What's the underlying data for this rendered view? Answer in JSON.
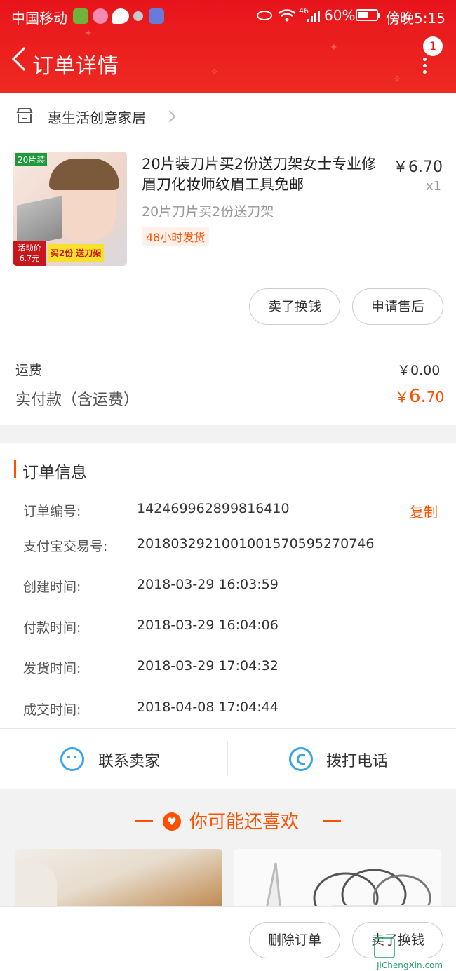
{
  "status_bar": {
    "carrier": "中国移动",
    "net": "46",
    "battery": "60%",
    "battery_level": 0.6,
    "time": "傍晚5:15"
  },
  "header": {
    "title": "订单详情",
    "badge": "1"
  },
  "shop": {
    "name": "惠生活创意家居"
  },
  "product": {
    "title": "20片装刀片买2份送刀架女士专业修眉刀化妆师纹眉工具免邮",
    "price": "￥6.70",
    "qty": "x1",
    "spec": "20片刀片买2份送刀架",
    "tag": "48小时发货",
    "image_texts": {
      "count_tag": "20片装",
      "promo_label": "活动价",
      "promo_price": "6.7元",
      "promo_banner": "买2份 送刀架"
    }
  },
  "item_actions": {
    "sell": "卖了换钱",
    "after_sale": "申请售后"
  },
  "totals": {
    "shipping_label": "运费",
    "shipping_value": "￥0.00",
    "paid_label": "实付款（含运费）",
    "paid_currency": "￥",
    "paid_int": "6.",
    "paid_dec": "70"
  },
  "order_info": {
    "heading": "订单信息",
    "copy": "复制",
    "rows": [
      {
        "label": "订单编号:",
        "value": "142469962899816410"
      },
      {
        "label": "支付宝交易号:",
        "value": "2018032921001001570595270746"
      },
      {
        "label": "创建时间:",
        "value": "2018-03-29 16:03:59"
      },
      {
        "label": "付款时间:",
        "value": "2018-03-29 16:04:06"
      },
      {
        "label": "发货时间:",
        "value": "2018-03-29 17:04:32"
      },
      {
        "label": "成交时间:",
        "value": "2018-04-08 17:04:44"
      }
    ]
  },
  "contact": {
    "seller": "联系卖家",
    "call": "拨打电话"
  },
  "recommend": {
    "title": "你可能还喜欢"
  },
  "footer": {
    "delete": "删除订单",
    "sell": "卖了换钱"
  },
  "watermark": {
    "text": "JiChengXin.com"
  },
  "colors": {
    "header": "#e8141b",
    "accent": "#ff5000",
    "contact_icon": "#3aa4e8"
  }
}
